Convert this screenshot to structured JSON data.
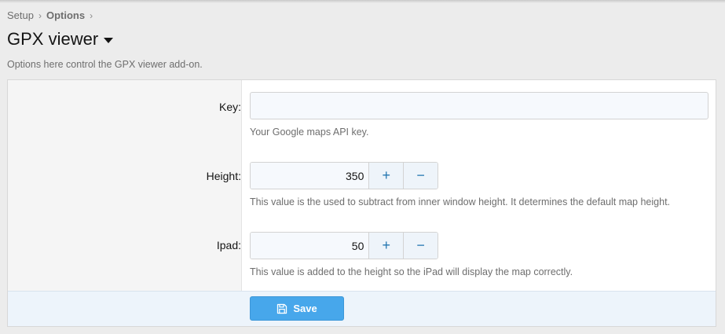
{
  "breadcrumb": {
    "items": [
      "Setup",
      "Options"
    ],
    "separator": "›"
  },
  "page": {
    "title": "GPX viewer",
    "description": "Options here control the GPX viewer add-on."
  },
  "form": {
    "key": {
      "label": "Key:",
      "value": "",
      "hint": "Your Google maps API key."
    },
    "height": {
      "label": "Height:",
      "value": "350",
      "increment": "+",
      "decrement": "−",
      "hint": "This value is the used to subtract from inner window height. It determines the default map height."
    },
    "ipad": {
      "label": "Ipad:",
      "value": "50",
      "increment": "+",
      "decrement": "−",
      "hint": "This value is added to the height so the iPad will display the map correctly."
    },
    "save_label": "Save"
  },
  "icons": {
    "title_menu": "caret-down-icon",
    "save": "floppy-disk-icon"
  },
  "colors": {
    "accent": "#47a7eb",
    "spin_icon": "#2577b1",
    "footer_bg": "#edf4fb"
  }
}
